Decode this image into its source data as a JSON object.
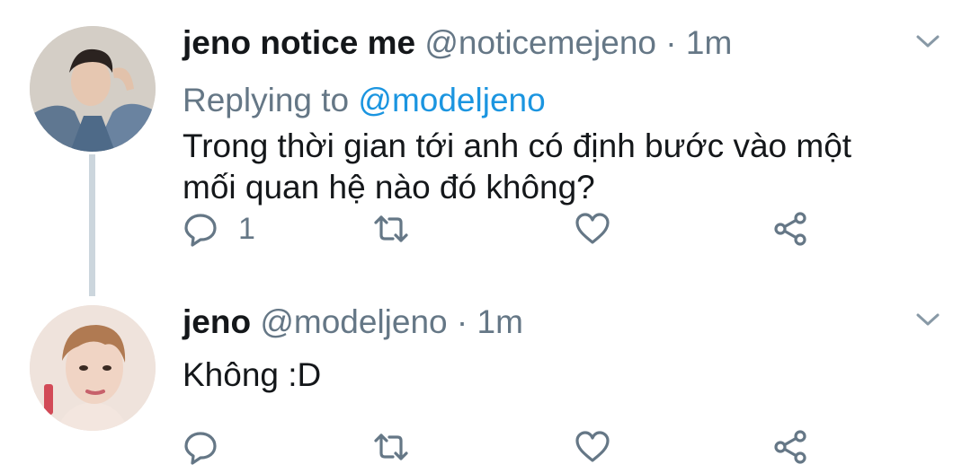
{
  "tweets": [
    {
      "name": "jeno notice me",
      "handle": "@noticemejeno",
      "separator": "·",
      "time": "1m",
      "replying_prefix": "Replying to",
      "replying_to": "@modeljeno",
      "text_line1": "Trong thời gian tới anh có định bước vào một",
      "text_line2": "mối quan hệ nào đó không?",
      "reply_count": "1",
      "icons": [
        "reply-icon",
        "retweet-icon",
        "like-icon",
        "share-icon",
        "chevron-down-icon"
      ]
    },
    {
      "name": "jeno",
      "handle": "@modeljeno",
      "separator": "·",
      "time": "1m",
      "text": "Không :D",
      "reply_count": "",
      "icons": [
        "reply-icon",
        "retweet-icon",
        "like-icon",
        "share-icon",
        "chevron-down-icon"
      ]
    }
  ],
  "colors": {
    "text": "#14171a",
    "secondary": "#657786",
    "link": "#1b95e0",
    "thread_line": "#ccd6dd"
  }
}
